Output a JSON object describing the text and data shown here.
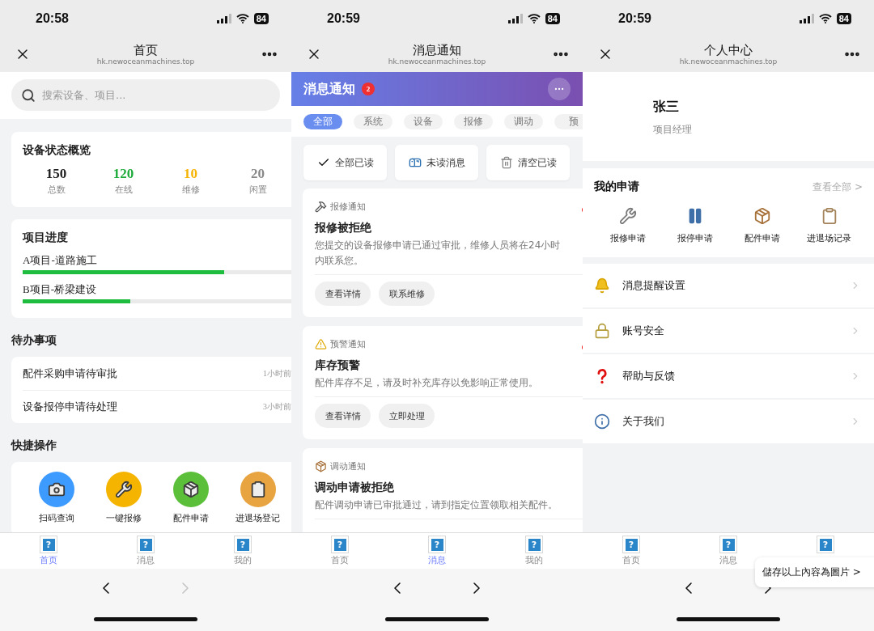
{
  "screens": [
    {
      "kind": "home",
      "status": {
        "time": "20:58",
        "battery": "84"
      },
      "nav": {
        "title": "首页",
        "url": "hk.newoceanmachines.top"
      },
      "search": {
        "placeholder": "搜索设备、项目..."
      },
      "overview": {
        "title": "设备状态概览",
        "stats": [
          {
            "value": "150",
            "label": "总数",
            "color": "#222222"
          },
          {
            "value": "120",
            "label": "在线",
            "color": "#1faa3c"
          },
          {
            "value": "10",
            "label": "维修",
            "color": "#f5b300"
          },
          {
            "value": "20",
            "label": "闲置",
            "color": "#888888"
          }
        ]
      },
      "progress": {
        "title": "项目进度",
        "projects": [
          {
            "label": "A项目-道路施工",
            "level": 0.75
          },
          {
            "label": "B项目-桥梁建设",
            "level": 0.4
          }
        ]
      },
      "todo": {
        "title": "待办事项",
        "items": [
          {
            "text": "配件采购申请待审批",
            "time": "1小时前"
          },
          {
            "text": "设备报停申请待处理",
            "time": "3小时前"
          }
        ]
      },
      "shortcuts": {
        "title": "快捷操作",
        "items": [
          {
            "label": "扫码查询",
            "kind": "camera",
            "color": "#3d9bff"
          },
          {
            "label": "一键报修",
            "kind": "wrench",
            "color": "#f5b400"
          },
          {
            "label": "配件申请",
            "kind": "box",
            "color": "#5cbf3a"
          },
          {
            "label": "进退场登记",
            "kind": "clipboard",
            "color": "#e8a440"
          }
        ]
      },
      "tabs": [
        {
          "icon": "?",
          "label": "首页",
          "selected": true
        },
        {
          "icon": "?",
          "label": "消息",
          "selected": false
        },
        {
          "icon": "?",
          "label": "我的",
          "selected": false
        }
      ],
      "browser": {
        "forward_enabled": false
      }
    },
    {
      "kind": "messages",
      "status": {
        "time": "20:59",
        "battery": "84"
      },
      "nav": {
        "title": "消息通知",
        "url": "hk.newoceanmachines.top"
      },
      "header": {
        "title": "消息通知",
        "badge": "2"
      },
      "filters": [
        {
          "label": "全部",
          "selected": true
        },
        {
          "label": "系统",
          "selected": false
        },
        {
          "label": "设备",
          "selected": false
        },
        {
          "label": "报修",
          "selected": false
        },
        {
          "label": "调动",
          "selected": false
        },
        {
          "label": "预",
          "selected": false
        }
      ],
      "actions": [
        {
          "kind": "check",
          "label": "全部已读"
        },
        {
          "kind": "mailbox",
          "label": "未读消息"
        },
        {
          "kind": "trash",
          "label": "清空已读"
        }
      ],
      "messages": [
        {
          "kind": "hammer",
          "category": "报修通知",
          "title": "报修被拒绝",
          "body": "您提交的设备报修申请已通过审批，维修人员将在24小时内联系您。",
          "unread": true,
          "buttons": [
            "查看详情",
            "联系维修"
          ]
        },
        {
          "kind": "warning",
          "category": "预警通知",
          "title": "库存预警",
          "body": "配件库存不足，请及时补充库存以免影响正常使用。",
          "unread": true,
          "buttons": [
            "查看详情",
            "立即处理"
          ]
        },
        {
          "kind": "box",
          "category": "调动通知",
          "title": "调动申请被拒绝",
          "body": "配件调动申请已审批通过，请到指定位置领取相关配件。",
          "unread": false
        }
      ],
      "tabs": [
        {
          "icon": "?",
          "label": "首页",
          "selected": false
        },
        {
          "icon": "?",
          "label": "消息",
          "selected": true
        },
        {
          "icon": "?",
          "label": "我的",
          "selected": false
        }
      ],
      "browser": {
        "forward_enabled": true
      }
    },
    {
      "kind": "profile",
      "status": {
        "time": "20:59",
        "battery": "84"
      },
      "nav": {
        "title": "个人中心",
        "url": "hk.newoceanmachines.top"
      },
      "user": {
        "name": "张三",
        "role": "项目经理"
      },
      "applications": {
        "title": "我的申请",
        "link": "查看全部 >",
        "items": [
          {
            "kind": "wrench",
            "label": "报修申请"
          },
          {
            "kind": "pause",
            "label": "报停申请"
          },
          {
            "kind": "box",
            "label": "配件申请"
          },
          {
            "kind": "clipboard",
            "label": "进退场记录"
          }
        ]
      },
      "menu": [
        {
          "kind": "bell",
          "label": "消息提醒设置"
        },
        {
          "kind": "lock",
          "label": "账号安全"
        },
        {
          "kind": "help",
          "label": "帮助与反馈"
        },
        {
          "kind": "info",
          "label": "关于我们"
        }
      ],
      "tabs": [
        {
          "icon": "?",
          "label": "首页"
        },
        {
          "icon": "?",
          "label": "消息"
        },
        {
          "icon": "?"
        }
      ],
      "browser": {
        "forward_enabled": true
      },
      "popup": {
        "text": "儲存以上內容為圖片 >"
      }
    }
  ]
}
